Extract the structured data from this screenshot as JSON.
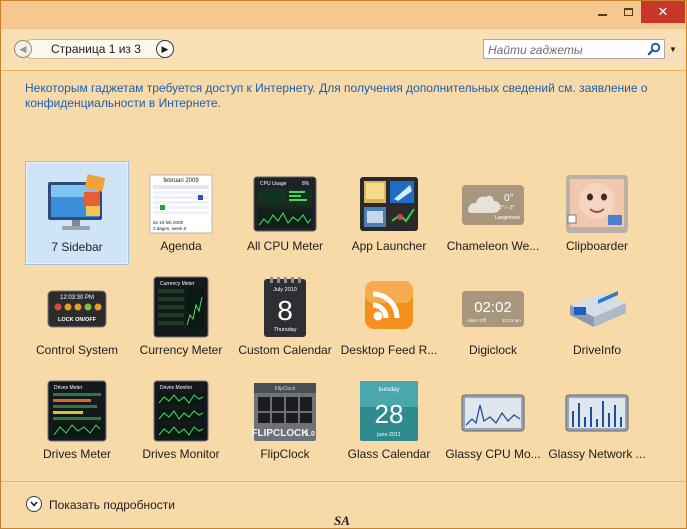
{
  "toolbar": {
    "page_label": "Страница 1 из 3",
    "search_placeholder": "Найти гаджеты"
  },
  "info_text": "Некоторым гаджетам требуется доступ к Интернету. Для получения дополнительных сведений см. заявление о конфиденциальности в Интернете.",
  "gadgets": [
    {
      "label": "7 Sidebar",
      "icon": "monitor-sidebar-icon",
      "selected": true
    },
    {
      "label": "Agenda",
      "icon": "calendar-agenda-icon"
    },
    {
      "label": "All CPU Meter",
      "icon": "cpu-meter-icon"
    },
    {
      "label": "App Launcher",
      "icon": "app-launcher-icon"
    },
    {
      "label": "Chameleon We...",
      "icon": "weather-cloud-icon"
    },
    {
      "label": "Clipboarder",
      "icon": "clipboard-photo-icon"
    },
    {
      "label": "Control System",
      "icon": "control-system-icon"
    },
    {
      "label": "Currency Meter",
      "icon": "currency-meter-icon"
    },
    {
      "label": "Custom Calendar",
      "icon": "custom-calendar-icon"
    },
    {
      "label": "Desktop Feed R...",
      "icon": "rss-feed-icon"
    },
    {
      "label": "Digiclock",
      "icon": "digital-clock-icon"
    },
    {
      "label": "DriveInfo",
      "icon": "hard-drive-icon"
    },
    {
      "label": "Drives Meter",
      "icon": "drives-meter-icon"
    },
    {
      "label": "Drives Monitor",
      "icon": "drives-monitor-icon"
    },
    {
      "label": "FlipClock",
      "icon": "flip-clock-icon"
    },
    {
      "label": "Glass Calendar",
      "icon": "glass-calendar-icon"
    },
    {
      "label": "Glassy CPU Mo...",
      "icon": "glassy-cpu-icon"
    },
    {
      "label": "Glassy Network ...",
      "icon": "glassy-network-icon"
    }
  ],
  "icon_text": {
    "agenda_month": "februari 2009",
    "agenda_footer": "do 19 feb 2009",
    "agenda_week": "3 dagen, week 8",
    "cpu_title": "CPU Usage",
    "cpu_percent": "8%",
    "weather_temp": "0°",
    "weather_range": "3° / -2°",
    "weather_place": "Langemark",
    "control_time": "12:03:30 PM",
    "control_lock": "LOCK ON/OFF",
    "currency_title": "Currency Meter",
    "calendar_month": "July 2010",
    "calendar_day": "8",
    "calendar_weekday": "Thursday",
    "digiclock_time": "02:02",
    "digiclock_left": "Alarm Off",
    "digiclock_right": "12:03 am",
    "drives_meter_title": "Drives Meter",
    "drives_monitor_title": "Drives Monitor",
    "flipclock_top": "FlipClock",
    "flipclock_brand": "FLIPCLOCK",
    "flipclock_version": "1.0",
    "glass_weekday": "tuesday",
    "glass_day": "28",
    "glass_month": "june 2011"
  },
  "details_label": "Показать подробности",
  "watermark": "SA",
  "colors": {
    "link": "#1b5fb4",
    "selected_tile": "#cfe4f6",
    "close_button": "#c7362a"
  }
}
